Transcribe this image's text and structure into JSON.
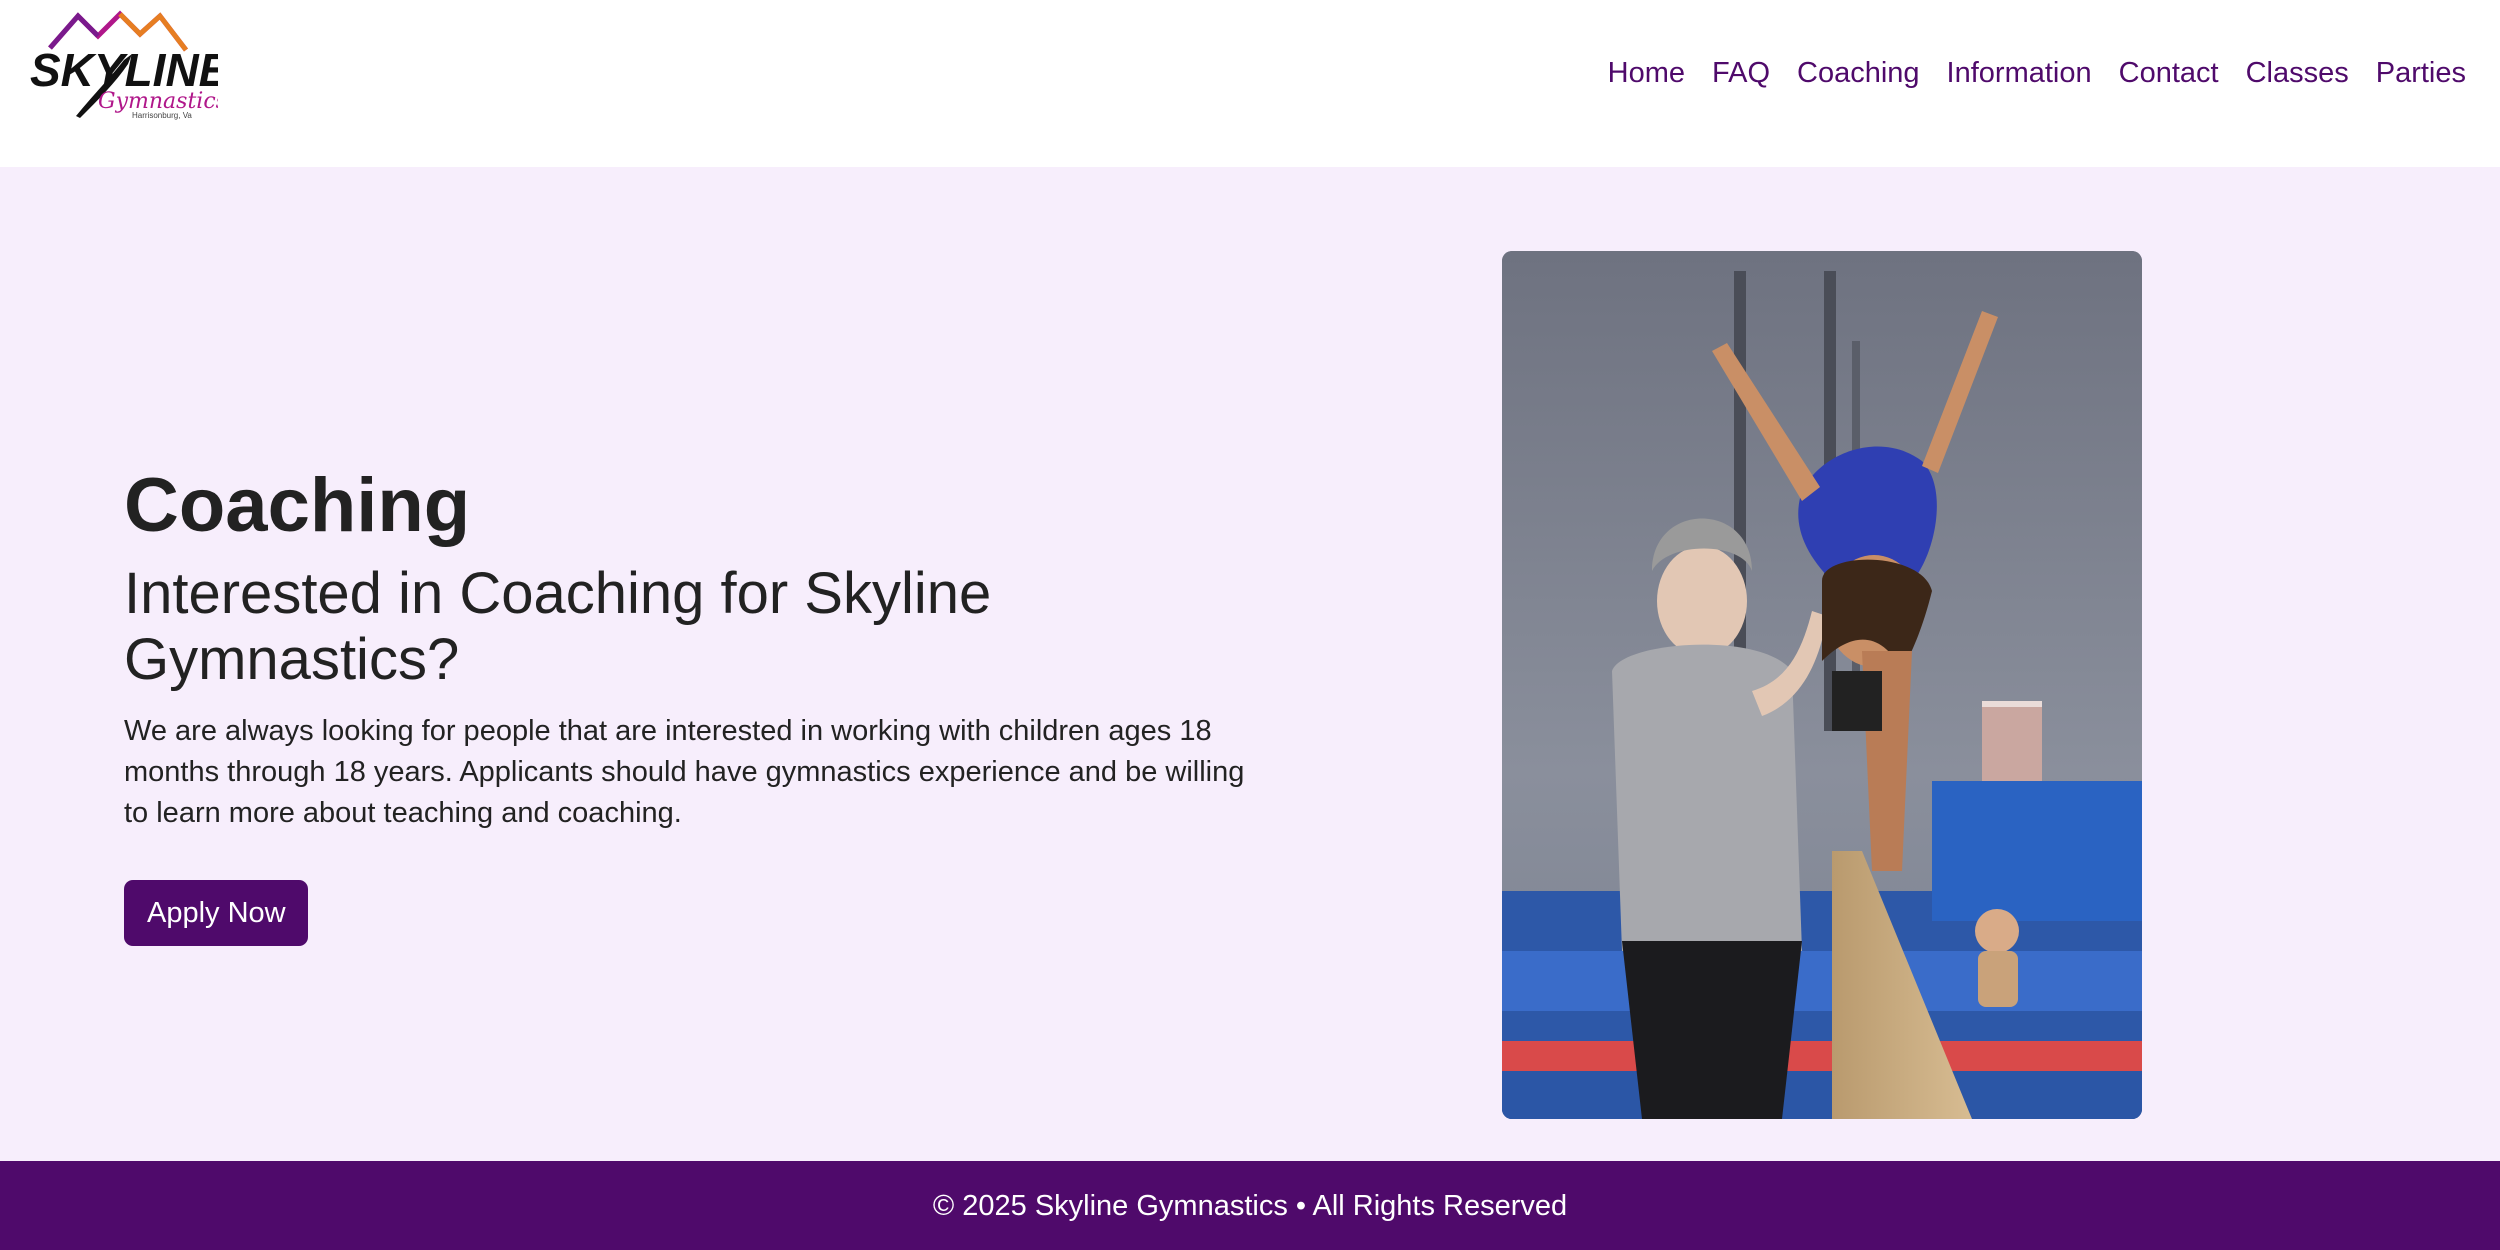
{
  "brand": {
    "logo_alt": "Skyline Gymnastics",
    "logo_word": "SKYLINE",
    "logo_script": "Gymnastics",
    "logo_location": "Harrisonburg, Va",
    "colors": {
      "purple": "#4f0a6b",
      "magenta": "#b0178a",
      "orange": "#e67e22"
    }
  },
  "nav": {
    "items": [
      {
        "label": "Home"
      },
      {
        "label": "FAQ"
      },
      {
        "label": "Coaching"
      },
      {
        "label": "Information"
      },
      {
        "label": "Contact"
      },
      {
        "label": "Classes"
      },
      {
        "label": "Parties"
      }
    ]
  },
  "hero": {
    "title": "Coaching",
    "subtitle": "Interested in Coaching for Skyline Gymnastics?",
    "body": "We are always looking for people that are interested in working with children ages 18 months through 18 years. Applicants should have gymnastics experience and be willing to learn more about teaching and coaching.",
    "cta_label": "Apply Now",
    "photo_alt": "Coach spotting a gymnast on the balance beam"
  },
  "footer": {
    "text": "© 2025 Skyline Gymnastics • All Rights Reserved"
  }
}
